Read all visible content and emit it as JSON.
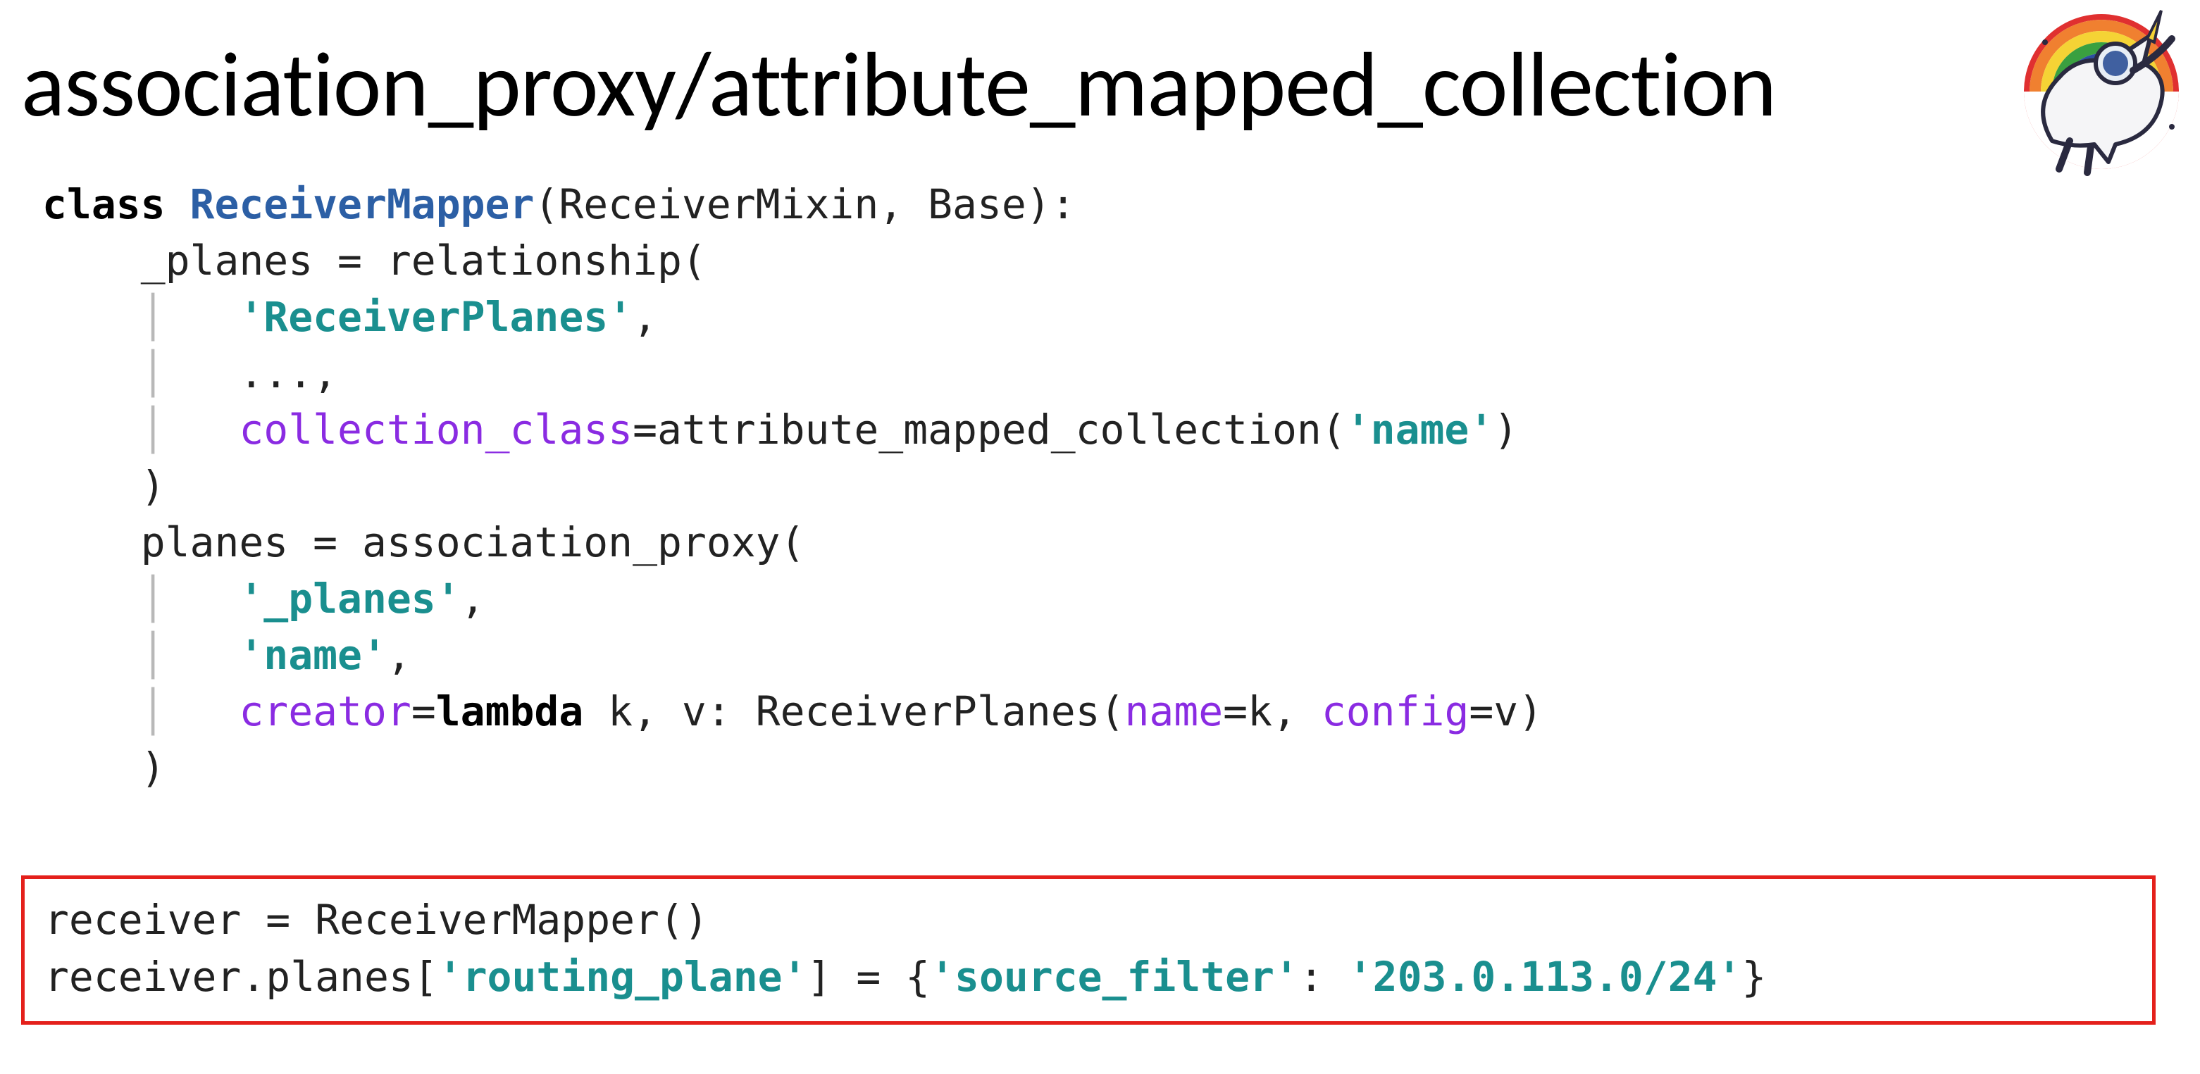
{
  "title": "association_proxy/attribute_mapped_collection",
  "code": {
    "class_kw": "class",
    "class_name": "ReceiverMapper",
    "class_bases": "(ReceiverMixin, Base):",
    "planes_priv": "_planes = relationship(",
    "rel_arg_str": "'ReceiverPlanes'",
    "rel_ellipsis": "...,",
    "cc_key": "collection_class",
    "cc_eq": "=attribute_mapped_collection(",
    "cc_str": "'name'",
    "cc_close": ")",
    "rel_close": ")",
    "planes_pub": "planes = association_proxy(",
    "ap_arg1": "'_planes'",
    "ap_arg2": "'name'",
    "creator_key": "creator",
    "creator_eq": "=",
    "lambda_kw": "lambda",
    "lambda_args": " k, v: ReceiverPlanes(",
    "name_kw": "name",
    "name_eq": "=k, ",
    "config_kw": "config",
    "config_eq": "=v)",
    "ap_close": ")"
  },
  "usage": {
    "line1_a": "receiver = ReceiverMapper()",
    "line2_a": "receiver.planes[",
    "line2_s1": "'routing_plane'",
    "line2_b": "] = {",
    "line2_s2": "'source_filter'",
    "line2_c": ": ",
    "line2_s3": "'203.0.113.0/24'",
    "line2_d": "}"
  }
}
